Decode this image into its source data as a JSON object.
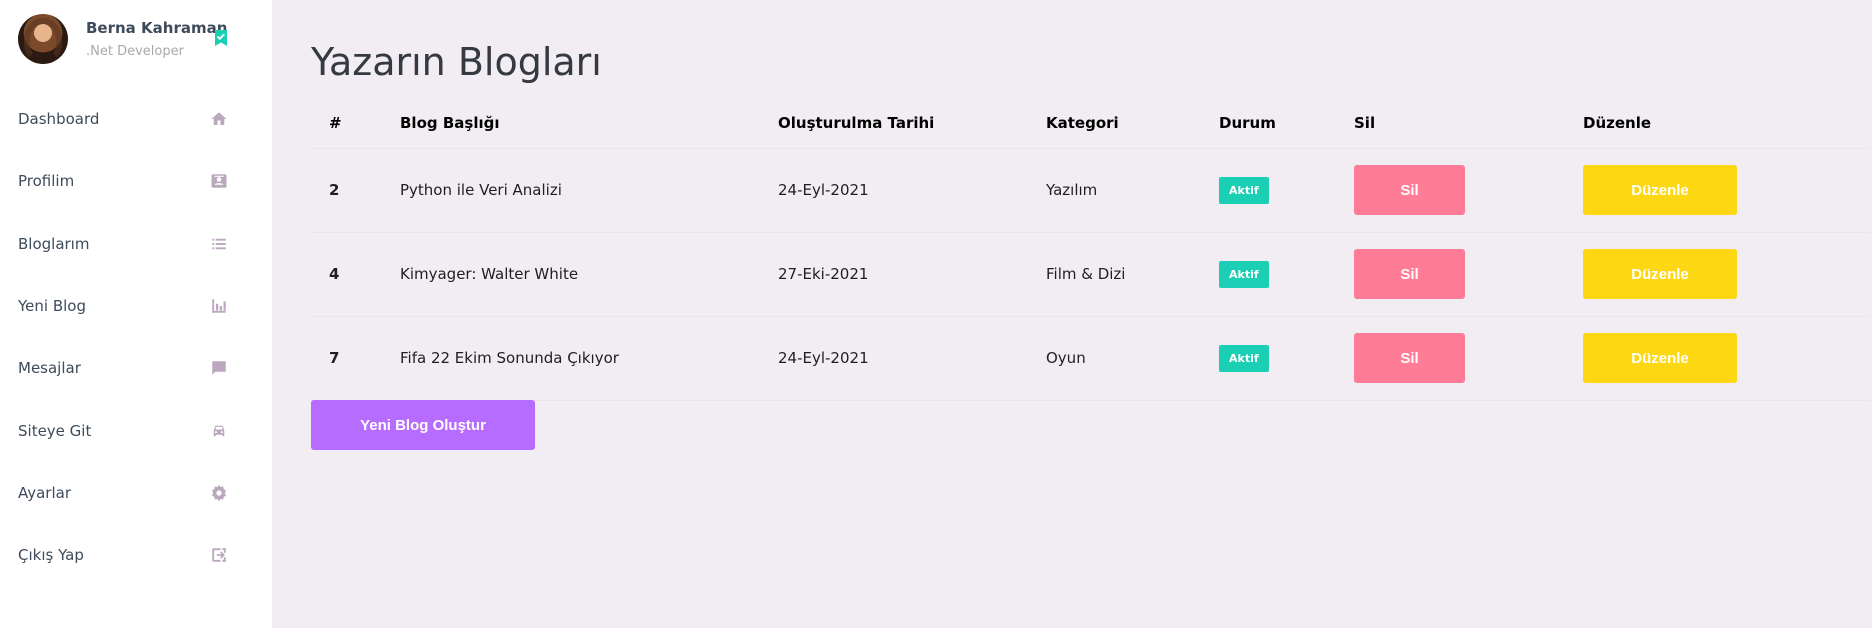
{
  "colors": {
    "sidebar_bg": "#ffffff",
    "content_bg": "#f2edf3",
    "accent_purple": "#b66dff",
    "status_green": "#1bcfb4",
    "delete_pink": "#fe7c96",
    "edit_yellow": "#fed713",
    "icon_muted": "#bba8bf"
  },
  "profile": {
    "name": "Berna Kahraman",
    "role": ".Net Developer",
    "verify_icon": "bookmark-check-icon"
  },
  "sidebar": {
    "items": [
      {
        "label": "Dashboard",
        "icon": "home-icon"
      },
      {
        "label": "Profilim",
        "icon": "contact-card-icon"
      },
      {
        "label": "Bloglarım",
        "icon": "list-icon"
      },
      {
        "label": "Yeni Blog",
        "icon": "bar-chart-icon"
      },
      {
        "label": "Mesajlar",
        "icon": "message-icon"
      },
      {
        "label": "Siteye Git",
        "icon": "car-icon"
      },
      {
        "label": "Ayarlar",
        "icon": "gear-icon"
      },
      {
        "label": "Çıkış Yap",
        "icon": "logout-icon"
      }
    ]
  },
  "main": {
    "title": "Yazarın Blogları",
    "table": {
      "headers": [
        "#",
        "Blog Başlığı",
        "Oluşturulma Tarihi",
        "Kategori",
        "Durum",
        "Sil",
        "Düzenle"
      ],
      "rows": [
        {
          "id": "2",
          "title": "Python ile Veri Analizi",
          "date": "24-Eyl-2021",
          "category": "Yazılım",
          "status": "Aktif",
          "delete": "Sil",
          "edit": "Düzenle"
        },
        {
          "id": "4",
          "title": "Kimyager: Walter White",
          "date": "27-Eki-2021",
          "category": "Film & Dizi",
          "status": "Aktif",
          "delete": "Sil",
          "edit": "Düzenle"
        },
        {
          "id": "7",
          "title": "Fifa 22 Ekim Sonunda Çıkıyor",
          "date": "24-Eyl-2021",
          "category": "Oyun",
          "status": "Aktif",
          "delete": "Sil",
          "edit": "Düzenle"
        }
      ]
    },
    "new_blog_button": "Yeni Blog Oluştur"
  }
}
